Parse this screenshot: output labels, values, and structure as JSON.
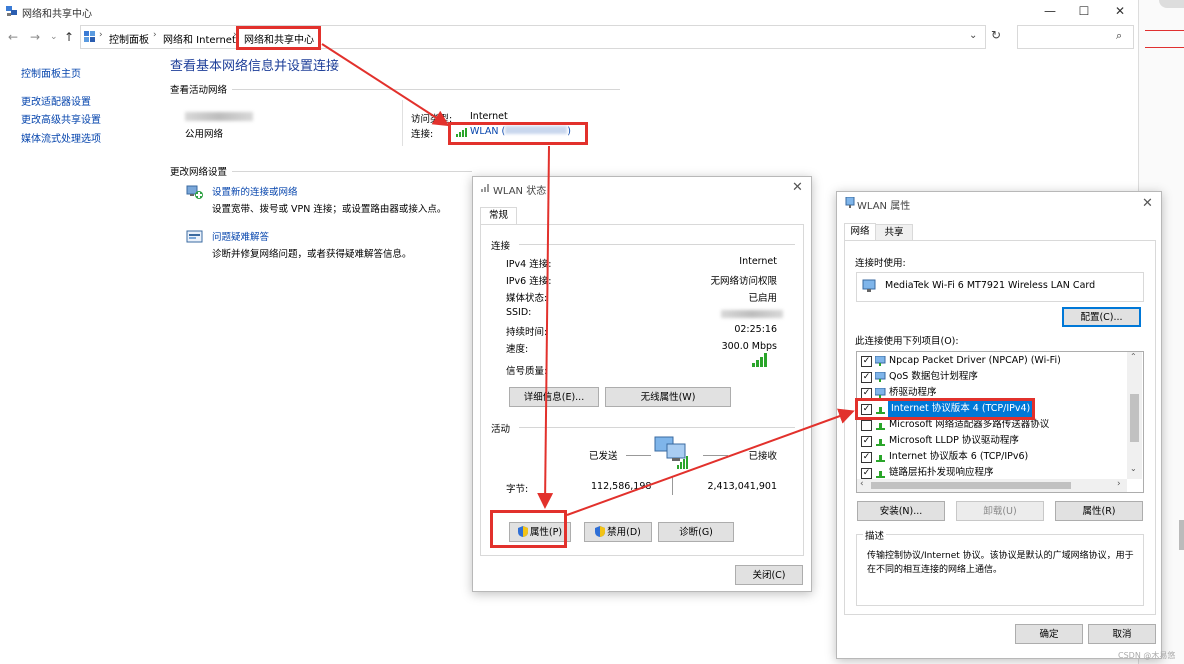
{
  "window": {
    "title": "网络和共享中心"
  },
  "address": {
    "crumbs": [
      "控制面板",
      "网络和 Internet",
      "网络和共享中心"
    ]
  },
  "leftnav": {
    "items": [
      "控制面板主页",
      "更改适配器设置",
      "更改高级共享设置",
      "媒体流式处理选项"
    ]
  },
  "main": {
    "heading": "查看基本网络信息并设置连接",
    "active_section": "查看活动网络",
    "network_type": "公用网络",
    "access_label": "访问类型:",
    "access_value": "Internet",
    "conn_label": "连接:",
    "conn_value_prefix": "WLAN (",
    "conn_value_suffix": ")",
    "change_section": "更改网络设置",
    "tasks": [
      {
        "link": "设置新的连接或网络",
        "desc": "设置宽带、拨号或 VPN 连接；或设置路由器或接入点。"
      },
      {
        "link": "问题疑难解答",
        "desc": "诊断并修复网络问题，或者获得疑难解答信息。"
      }
    ]
  },
  "status_dialog": {
    "title": "WLAN 状态",
    "tab": "常规",
    "conn_section": "连接",
    "rows": [
      {
        "label": "IPv4 连接:",
        "value": "Internet"
      },
      {
        "label": "IPv6 连接:",
        "value": "无网络访问权限"
      },
      {
        "label": "媒体状态:",
        "value": "已启用"
      },
      {
        "label": "SSID:",
        "value": ""
      },
      {
        "label": "持续时间:",
        "value": "02:25:16"
      },
      {
        "label": "速度:",
        "value": "300.0 Mbps"
      }
    ],
    "signal_label": "信号质量:",
    "details_btn": "详细信息(E)...",
    "wireless_btn": "无线属性(W)",
    "activity_section": "活动",
    "sent_label": "已发送",
    "recv_label": "已接收",
    "bytes_label": "字节:",
    "bytes_sent": "112,586,198",
    "bytes_recv": "2,413,041,901",
    "props_btn": "属性(P)",
    "disable_btn": "禁用(D)",
    "diagnose_btn": "诊断(G)",
    "close_btn": "关闭(C)"
  },
  "props_dialog": {
    "title": "WLAN 属性",
    "tabs": [
      "网络",
      "共享"
    ],
    "connect_using_label": "连接时使用:",
    "adapter": "MediaTek Wi-Fi 6 MT7921 Wireless LAN Card",
    "configure_btn": "配置(C)...",
    "items_label": "此连接使用下列项目(O):",
    "items": [
      {
        "label": "Npcap Packet Driver (NPCAP) (Wi-Fi)",
        "checked": true
      },
      {
        "label": "QoS 数据包计划程序",
        "checked": true
      },
      {
        "label": "桥驱动程序",
        "checked": true
      },
      {
        "label": "Internet 协议版本 4 (TCP/IPv4)",
        "checked": true
      },
      {
        "label": "Microsoft 网络适配器多路传送器协议",
        "checked": false
      },
      {
        "label": "Microsoft LLDP 协议驱动程序",
        "checked": true
      },
      {
        "label": "Internet 协议版本 6 (TCP/IPv6)",
        "checked": true
      },
      {
        "label": "链路层拓扑发现响应程序",
        "checked": true
      }
    ],
    "install_btn": "安装(N)...",
    "uninstall_btn": "卸载(U)",
    "properties_btn": "属性(R)",
    "desc_label": "描述",
    "desc_text": "传输控制协议/Internet 协议。该协议是默认的广域网络协议，用于在不同的相互连接的网络上通信。",
    "ok_btn": "确定",
    "cancel_btn": "取消"
  },
  "watermark": "CSDN @木易悠",
  "colors": {
    "annotation_red": "#e2312c",
    "link_blue": "#0645ad",
    "heading_blue": "#1e3f99",
    "selection_blue": "#0078d7"
  }
}
